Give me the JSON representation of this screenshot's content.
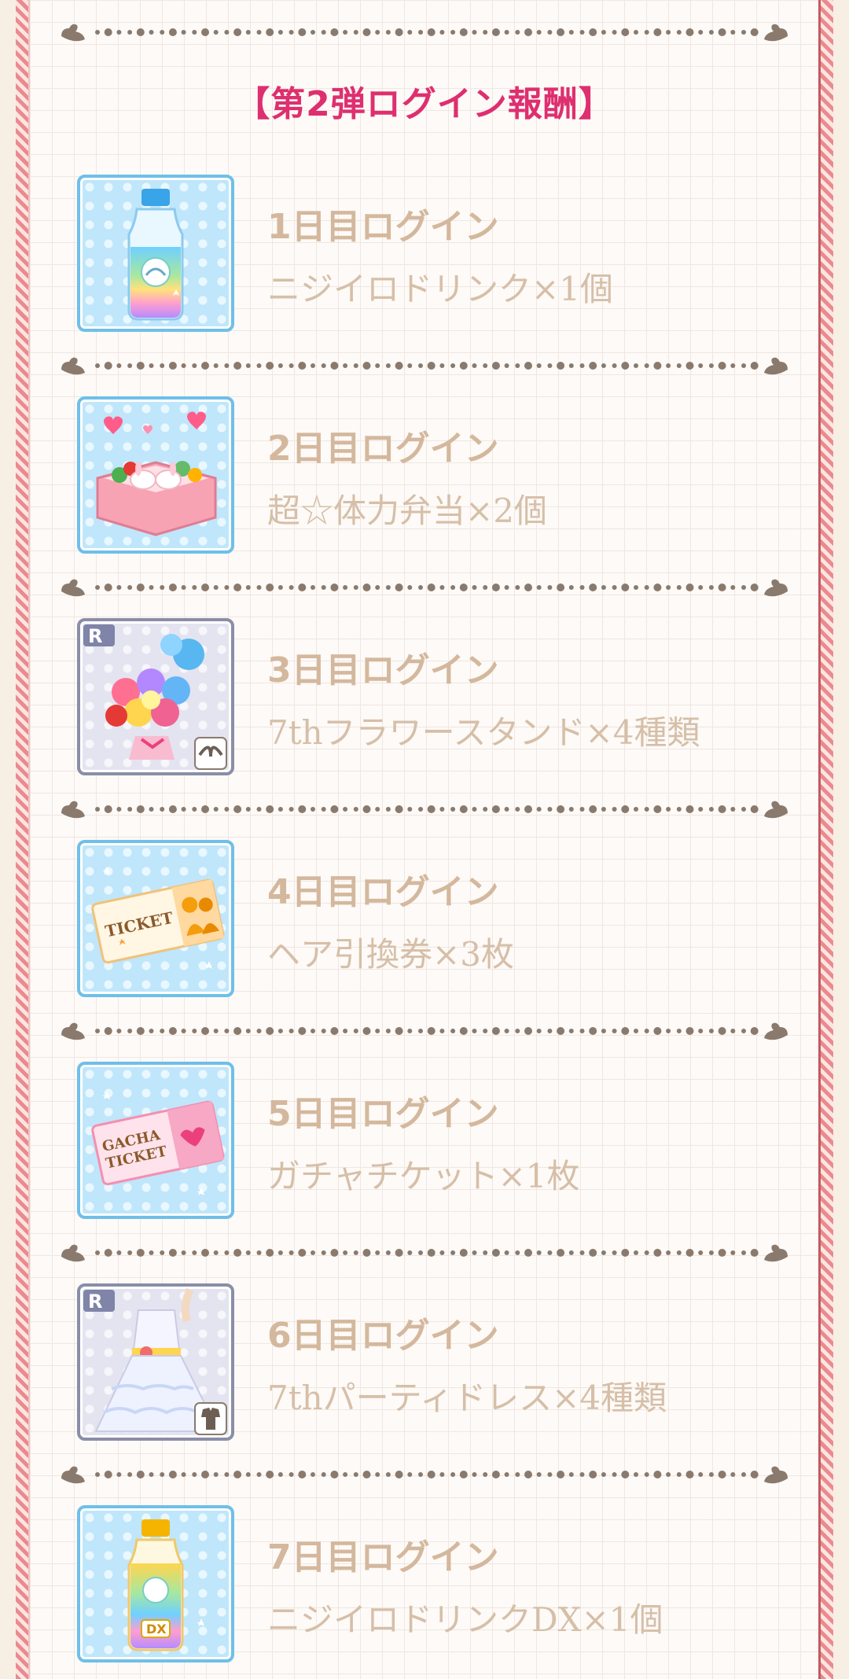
{
  "heading": "【第2弾ログイン報酬】",
  "rewards": [
    {
      "day_label": "1日目ログイン",
      "item": "ニジイロドリンク×1個",
      "icon": "rainbow-drink-icon"
    },
    {
      "day_label": "2日目ログイン",
      "item": "超☆体力弁当×2個",
      "icon": "bento-box-icon"
    },
    {
      "day_label": "3日目ログイン",
      "item": "7thフラワースタンド×4種類",
      "icon": "flower-stand-icon"
    },
    {
      "day_label": "4日目ログイン",
      "item": "ヘア引換券×3枚",
      "icon": "hair-ticket-icon"
    },
    {
      "day_label": "5日目ログイン",
      "item": "ガチャチケット×1枚",
      "icon": "gacha-ticket-icon"
    },
    {
      "day_label": "6日目ログイン",
      "item": "7thパーティドレス×4種類",
      "icon": "party-dress-icon"
    },
    {
      "day_label": "7日目ログイン",
      "item": "ニジイロドリンクDX×1個",
      "icon": "rainbow-drink-dx-icon"
    }
  ],
  "icon_text": {
    "rarity": "R",
    "ticket": "TICKET",
    "gacha_line1": "GACHA",
    "gacha_line2": "TICKET",
    "dx": "DX"
  },
  "colors": {
    "heading": "#de2f6f",
    "day_label": "#d4b89d",
    "item_label": "#d6bfa8",
    "divider": "#8a7a6e",
    "frame_stripe": "#ea8a8f",
    "tile_border": "#6fbfe9"
  }
}
